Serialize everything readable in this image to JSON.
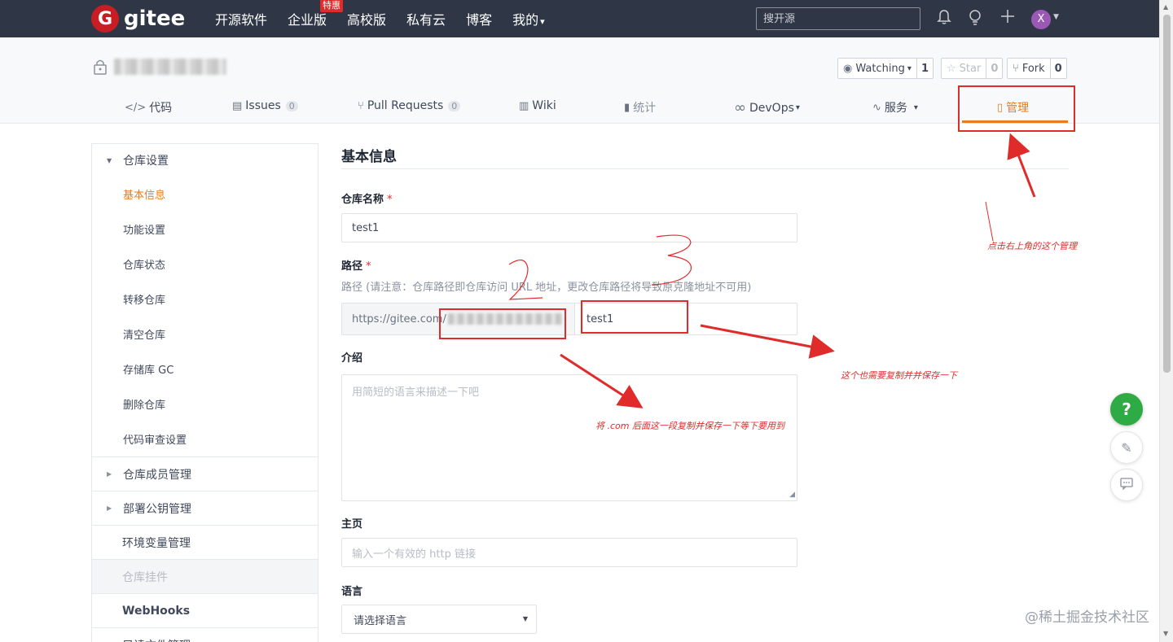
{
  "topbar": {
    "logo_mark": "G",
    "logo_text": "gitee",
    "nav": [
      "开源软件",
      "企业版",
      "高校版",
      "私有云",
      "博客",
      "我的"
    ],
    "hot_badge": "特惠",
    "my_caret": "▾",
    "search_placeholder": "搜开源",
    "bell_icon": "🔔",
    "bulb_icon": "💡",
    "plus_icon": "+",
    "avatar_letter": "X"
  },
  "repo": {
    "buttons": [
      {
        "label": "Watching",
        "caret": "▾",
        "count": "1"
      },
      {
        "label": "Star",
        "count": "0"
      },
      {
        "label": "Fork",
        "count": "0"
      }
    ],
    "tabs": [
      {
        "icon": "</>",
        "label": "代码"
      },
      {
        "icon": "▤",
        "label": "Issues",
        "count": "0"
      },
      {
        "icon": "⑂",
        "label": "Pull Requests",
        "count": "0"
      },
      {
        "icon": "▥",
        "label": "Wiki"
      },
      {
        "icon": "▮",
        "label": "统计"
      },
      {
        "icon": "∞",
        "label": "DevOps",
        "caret": "▾"
      },
      {
        "icon": "∿",
        "label": "服务",
        "caret": "▾"
      },
      {
        "icon": "▯",
        "label": "管理"
      }
    ]
  },
  "sidebar": {
    "group": "仓库设置",
    "items": [
      "基本信息",
      "功能设置",
      "仓库状态",
      "转移仓库",
      "清空仓库",
      "存储库 GC",
      "删除仓库",
      "代码审查设置"
    ],
    "sections": [
      "仓库成员管理",
      "部署公钥管理",
      "环境变量管理",
      "仓库挂件",
      "WebHooks",
      "只读文件管理"
    ]
  },
  "form": {
    "title": "基本信息",
    "name_label": "仓库名称",
    "required_mark": "*",
    "name_value": "test1",
    "path_label": "路径",
    "path_hint": "路径 (请注意：仓库路径即仓库访问 URL 地址，更改仓库路径将导致原克隆地址不可用)",
    "path_prefix": "https://gitee.com/",
    "path_value": "test1",
    "intro_label": "介绍",
    "intro_placeholder": "用简短的语言来描述一下吧",
    "homepage_label": "主页",
    "homepage_placeholder": "输入一个有效的 http 链接",
    "language_label": "语言",
    "language_value": "请选择语言"
  },
  "annotations": {
    "manage_note": "点击右上角的这个管理",
    "copy_note": "这个也需要复制并并保存一下",
    "com_note": "将 .com  后面这一段复制并保存一下等下要用到"
  },
  "floating": {
    "help": "?",
    "edit_icon": "✎",
    "chat_icon": "💬"
  },
  "watermark": "@稀土掘金技术社区",
  "colors": {
    "accent": "#e67d22",
    "brand": "#c71d23",
    "annotation": "#e02b2b",
    "help": "#2eab45"
  }
}
